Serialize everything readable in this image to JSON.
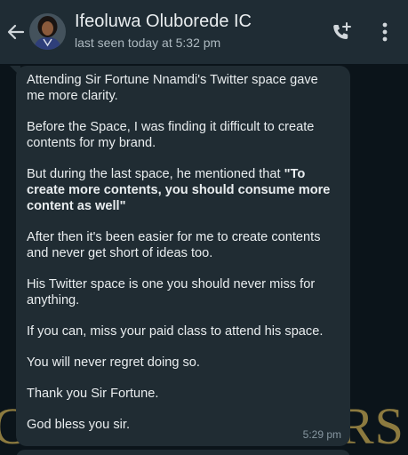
{
  "header": {
    "contact_name": "Ifeoluwa Oluborede IC",
    "status": "last seen today at 5:32 pm"
  },
  "icons": {
    "back": "arrow-left-icon",
    "avatar": "avatar",
    "call": "add-call-icon",
    "more": "more-vertical-icon"
  },
  "message": {
    "p1": "Attending Sir Fortune Nnamdi's Twitter space gave me more clarity.",
    "p2": "Before the Space, I was finding it difficult to create contents for my brand.",
    "p3_intro": "But during the last space, he mentioned that ",
    "p3_quote": "\"To create more contents, you should consume more content as well\"",
    "p4": "After then it's been easier for me to create contents and never get short of ideas too.",
    "p5": "His Twitter space is one you should never miss for anything.",
    "p6": "If you can, miss your paid class to attend his space.",
    "p7": "You will never regret doing so.",
    "p8": "Thank you Sir Fortune.",
    "p9": "God bless you sir.",
    "time": "5:29 pm"
  },
  "watermark": {
    "left": "C",
    "right": "RS"
  },
  "colors": {
    "header_bg": "#1f2c34",
    "chat_bg": "#0b141a",
    "bubble_bg": "#202c33",
    "text": "#e9edef",
    "subtext": "#aebac1",
    "watermark": "#8c7a3f"
  }
}
